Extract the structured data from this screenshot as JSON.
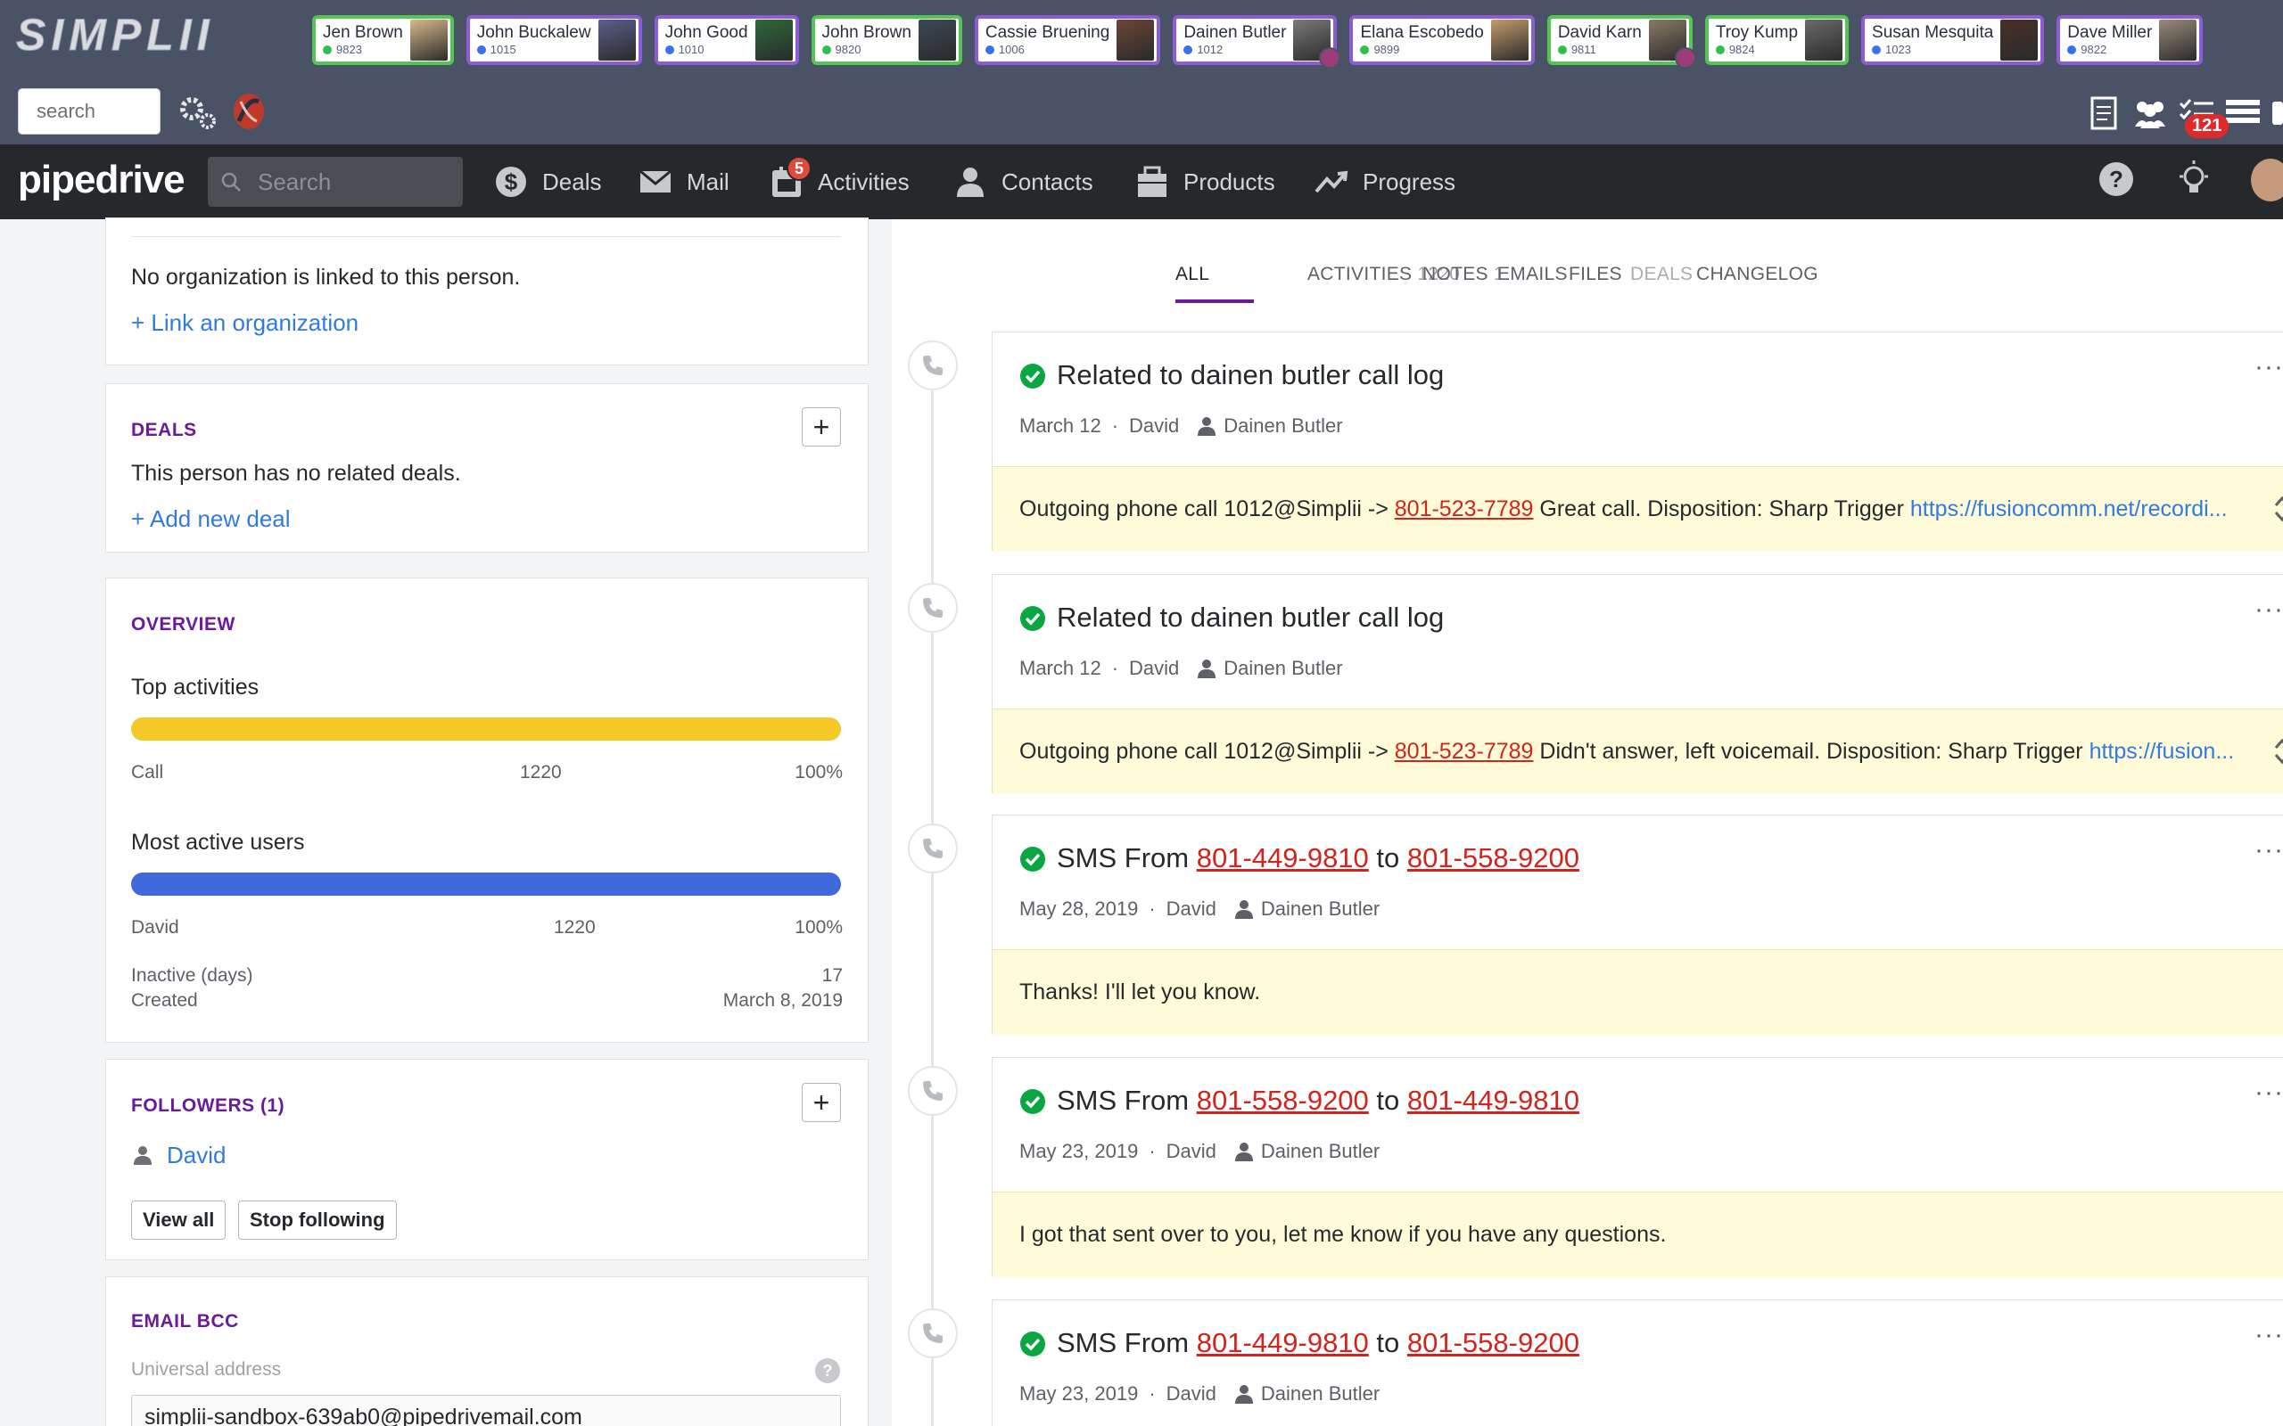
{
  "simplii": {
    "logo_text": "SIMPLII",
    "search_placeholder": "search",
    "users": [
      {
        "name": "Jen Brown",
        "ext": "9823",
        "status": "online",
        "dot": "#2fbf4a",
        "avatar": "#d8b98a"
      },
      {
        "name": "John Buckalew",
        "ext": "1015",
        "status": "away",
        "dot": "#3a6ff0",
        "avatar": "#5b5f8c"
      },
      {
        "name": "John Good",
        "ext": "1010",
        "status": "away",
        "dot": "#3a6ff0",
        "avatar": "#2d6a3a"
      },
      {
        "name": "John Brown",
        "ext": "9820",
        "status": "online",
        "dot": "#2fbf4a",
        "avatar": "#3c4a55"
      },
      {
        "name": "Cassie Bruening",
        "ext": "1006",
        "status": "away",
        "dot": "#3a6ff0",
        "avatar": "#6b4636"
      },
      {
        "name": "Dainen Butler",
        "ext": "1012",
        "status": "away",
        "dot": "#3a6ff0",
        "avatar": "#7a7a7a",
        "badge": true
      },
      {
        "name": "Elana Escobedo",
        "ext": "9899",
        "status": "away",
        "dot": "#2fbf4a",
        "avatar": "#c49a6c"
      },
      {
        "name": "David Karn",
        "ext": "9811",
        "status": "online",
        "dot": "#2fbf4a",
        "avatar": "#8a7a66",
        "badge": true
      },
      {
        "name": "Troy Kump",
        "ext": "9824",
        "status": "online",
        "dot": "#2fbf4a",
        "avatar": "#6a6a6a"
      },
      {
        "name": "Susan Mesquita",
        "ext": "1023",
        "status": "away",
        "dot": "#3a6ff0",
        "avatar": "#4a3028"
      },
      {
        "name": "Dave Miller",
        "ext": "9822",
        "status": "away",
        "dot": "#3a6ff0",
        "avatar": "#9a8a7a"
      }
    ],
    "tasks_badge": "121"
  },
  "pipedrive": {
    "logo": "pipedrive",
    "search_placeholder": "Search",
    "nav": [
      {
        "label": "Deals",
        "icon": "dollar-icon"
      },
      {
        "label": "Mail",
        "icon": "mail-icon"
      },
      {
        "label": "Activities",
        "icon": "calendar-icon",
        "badge": "5"
      },
      {
        "label": "Contacts",
        "icon": "person-icon"
      },
      {
        "label": "Products",
        "icon": "box-icon"
      },
      {
        "label": "Progress",
        "icon": "trend-icon"
      }
    ]
  },
  "left": {
    "organization": {
      "text": "No organization is linked to this person.",
      "link": "+ Link an organization"
    },
    "deals": {
      "title": "DEALS",
      "text": "This person has no related deals.",
      "link": "+ Add new deal"
    },
    "overview": {
      "title": "OVERVIEW",
      "top_activities_label": "Top activities",
      "top_activity": {
        "name": "Call",
        "count": "1220",
        "percent": "100%",
        "fill": 1.0,
        "color": "#f5c928"
      },
      "most_active_label": "Most active users",
      "most_active": {
        "name": "David",
        "count": "1220",
        "percent": "100%",
        "fill": 1.0,
        "color": "#4069db"
      },
      "inactive_label": "Inactive (days)",
      "inactive_value": "17",
      "created_label": "Created",
      "created_value": "March 8, 2019"
    },
    "followers": {
      "title": "FOLLOWERS (1)",
      "follower": "David",
      "view_all": "View all",
      "stop_following": "Stop following"
    },
    "email_bcc": {
      "title": "EMAIL BCC",
      "label": "Universal address",
      "value": "simplii-sandbox-639ab0@pipedrivemail.com"
    }
  },
  "tabs": [
    {
      "label": "ALL",
      "count": "",
      "state": "active"
    },
    {
      "label": "ACTIVITIES",
      "count": "1220",
      "state": "normal"
    },
    {
      "label": "NOTES",
      "count": "1",
      "state": "normal"
    },
    {
      "label": "EMAILS",
      "count": "",
      "state": "normal"
    },
    {
      "label": "FILES",
      "count": "",
      "state": "normal"
    },
    {
      "label": "DEALS",
      "count": "",
      "state": "disabled"
    },
    {
      "label": "CHANGELOG",
      "count": "",
      "state": "normal"
    }
  ],
  "feed": [
    {
      "title": "Related to dainen butler call log",
      "date": "March 12",
      "owner": "David",
      "person": "Dainen Butler",
      "body_prefix": "Outgoing phone call 1012@Simplii -> ",
      "body_phone": "801-523-7789",
      "body_text": " Great call. Disposition: Sharp Trigger ",
      "body_url": "https://fusioncomm.net/recordi..."
    },
    {
      "title": "Related to dainen butler call log",
      "date": "March 12",
      "owner": "David",
      "person": "Dainen Butler",
      "body_prefix": "Outgoing phone call 1012@Simplii -> ",
      "body_phone": "801-523-7789",
      "body_text": " Didn't answer, left voicemail. Disposition: Sharp Trigger ",
      "body_url": "https://fusion..."
    },
    {
      "title_prefix": "SMS From ",
      "from": "801-449-9810",
      "mid": " to ",
      "to": "801-558-9200",
      "date": "May 28, 2019",
      "owner": "David",
      "person": "Dainen Butler",
      "body": "Thanks! I'll let you know."
    },
    {
      "title_prefix": "SMS From ",
      "from": "801-558-9200",
      "mid": " to ",
      "to": "801-449-9810",
      "date": "May 23, 2019",
      "owner": "David",
      "person": "Dainen Butler",
      "body": "I got that sent over to you, let me know if you have any questions."
    },
    {
      "title_prefix": "SMS From ",
      "from": "801-449-9810",
      "mid": " to ",
      "to": "801-558-9200",
      "date": "May 23, 2019",
      "owner": "David",
      "person": "Dainen Butler"
    }
  ],
  "meta_sep": "·"
}
